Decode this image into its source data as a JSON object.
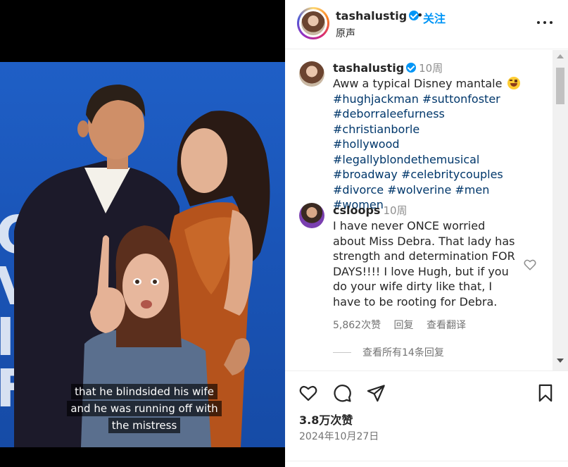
{
  "media": {
    "caption_lines": [
      "that he blindsided his wife",
      "and he was running off with",
      "the mistress"
    ],
    "backdrop_text": [
      "CK",
      "VI",
      "I",
      "F"
    ]
  },
  "header": {
    "username": "tashalustig",
    "separator": "•",
    "follow_label": "关注",
    "subtitle": "原声"
  },
  "post_caption": {
    "username": "tashalustig",
    "age": "10周",
    "text": "Aww a typical Disney mantale",
    "hashtags": [
      "#hughjackman",
      "#suttonfoster",
      "#deborraleefurness",
      "#christianborle",
      "#hollywood",
      "#legallyblondethemusical",
      "#broadway",
      "#celebritycouples",
      "#divorce",
      "#wolverine",
      "#men",
      "#women"
    ]
  },
  "comment": {
    "username": "csloops",
    "age": "10周",
    "text": "I have never ONCE worried about Miss Debra. That lady has strength and determination FOR DAYS!!!! I love Hugh, but if you do your wife dirty like that, I have to be rooting for Debra.",
    "likes": "5,862次赞",
    "reply_label": "回复",
    "translate_label": "查看翻译",
    "view_replies": "查看所有14条回复"
  },
  "footer": {
    "likes": "3.8万次赞",
    "date": "2024年10月27日"
  },
  "colors": {
    "accent": "#0095f6",
    "hashtag": "#00376b",
    "muted": "#737373",
    "photo_background": "#1a55b8"
  }
}
